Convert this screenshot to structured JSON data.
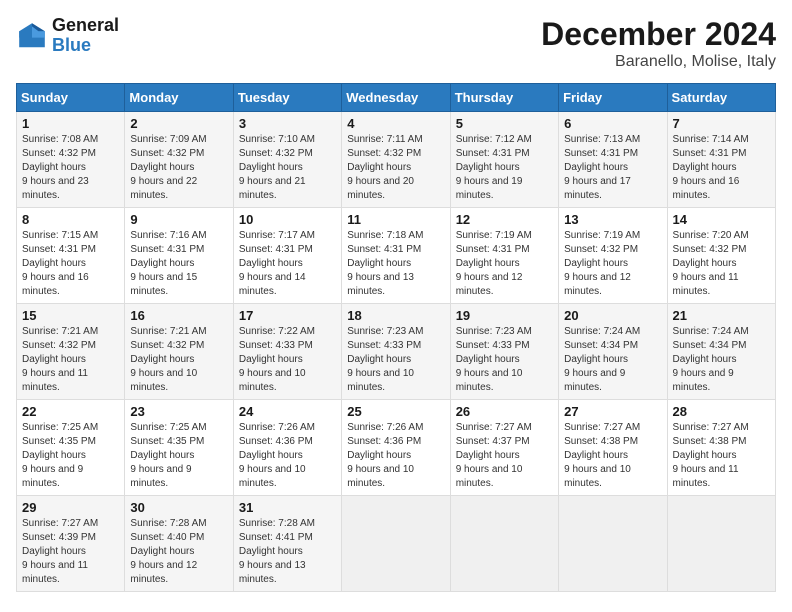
{
  "header": {
    "logo_line1": "General",
    "logo_line2": "Blue",
    "month": "December 2024",
    "location": "Baranello, Molise, Italy"
  },
  "weekdays": [
    "Sunday",
    "Monday",
    "Tuesday",
    "Wednesday",
    "Thursday",
    "Friday",
    "Saturday"
  ],
  "weeks": [
    [
      {
        "day": "1",
        "sunrise": "7:08 AM",
        "sunset": "4:32 PM",
        "daylight": "9 hours and 23 minutes."
      },
      {
        "day": "2",
        "sunrise": "7:09 AM",
        "sunset": "4:32 PM",
        "daylight": "9 hours and 22 minutes."
      },
      {
        "day": "3",
        "sunrise": "7:10 AM",
        "sunset": "4:32 PM",
        "daylight": "9 hours and 21 minutes."
      },
      {
        "day": "4",
        "sunrise": "7:11 AM",
        "sunset": "4:32 PM",
        "daylight": "9 hours and 20 minutes."
      },
      {
        "day": "5",
        "sunrise": "7:12 AM",
        "sunset": "4:31 PM",
        "daylight": "9 hours and 19 minutes."
      },
      {
        "day": "6",
        "sunrise": "7:13 AM",
        "sunset": "4:31 PM",
        "daylight": "9 hours and 17 minutes."
      },
      {
        "day": "7",
        "sunrise": "7:14 AM",
        "sunset": "4:31 PM",
        "daylight": "9 hours and 16 minutes."
      }
    ],
    [
      {
        "day": "8",
        "sunrise": "7:15 AM",
        "sunset": "4:31 PM",
        "daylight": "9 hours and 16 minutes."
      },
      {
        "day": "9",
        "sunrise": "7:16 AM",
        "sunset": "4:31 PM",
        "daylight": "9 hours and 15 minutes."
      },
      {
        "day": "10",
        "sunrise": "7:17 AM",
        "sunset": "4:31 PM",
        "daylight": "9 hours and 14 minutes."
      },
      {
        "day": "11",
        "sunrise": "7:18 AM",
        "sunset": "4:31 PM",
        "daylight": "9 hours and 13 minutes."
      },
      {
        "day": "12",
        "sunrise": "7:19 AM",
        "sunset": "4:31 PM",
        "daylight": "9 hours and 12 minutes."
      },
      {
        "day": "13",
        "sunrise": "7:19 AM",
        "sunset": "4:32 PM",
        "daylight": "9 hours and 12 minutes."
      },
      {
        "day": "14",
        "sunrise": "7:20 AM",
        "sunset": "4:32 PM",
        "daylight": "9 hours and 11 minutes."
      }
    ],
    [
      {
        "day": "15",
        "sunrise": "7:21 AM",
        "sunset": "4:32 PM",
        "daylight": "9 hours and 11 minutes."
      },
      {
        "day": "16",
        "sunrise": "7:21 AM",
        "sunset": "4:32 PM",
        "daylight": "9 hours and 10 minutes."
      },
      {
        "day": "17",
        "sunrise": "7:22 AM",
        "sunset": "4:33 PM",
        "daylight": "9 hours and 10 minutes."
      },
      {
        "day": "18",
        "sunrise": "7:23 AM",
        "sunset": "4:33 PM",
        "daylight": "9 hours and 10 minutes."
      },
      {
        "day": "19",
        "sunrise": "7:23 AM",
        "sunset": "4:33 PM",
        "daylight": "9 hours and 10 minutes."
      },
      {
        "day": "20",
        "sunrise": "7:24 AM",
        "sunset": "4:34 PM",
        "daylight": "9 hours and 9 minutes."
      },
      {
        "day": "21",
        "sunrise": "7:24 AM",
        "sunset": "4:34 PM",
        "daylight": "9 hours and 9 minutes."
      }
    ],
    [
      {
        "day": "22",
        "sunrise": "7:25 AM",
        "sunset": "4:35 PM",
        "daylight": "9 hours and 9 minutes."
      },
      {
        "day": "23",
        "sunrise": "7:25 AM",
        "sunset": "4:35 PM",
        "daylight": "9 hours and 9 minutes."
      },
      {
        "day": "24",
        "sunrise": "7:26 AM",
        "sunset": "4:36 PM",
        "daylight": "9 hours and 10 minutes."
      },
      {
        "day": "25",
        "sunrise": "7:26 AM",
        "sunset": "4:36 PM",
        "daylight": "9 hours and 10 minutes."
      },
      {
        "day": "26",
        "sunrise": "7:27 AM",
        "sunset": "4:37 PM",
        "daylight": "9 hours and 10 minutes."
      },
      {
        "day": "27",
        "sunrise": "7:27 AM",
        "sunset": "4:38 PM",
        "daylight": "9 hours and 10 minutes."
      },
      {
        "day": "28",
        "sunrise": "7:27 AM",
        "sunset": "4:38 PM",
        "daylight": "9 hours and 11 minutes."
      }
    ],
    [
      {
        "day": "29",
        "sunrise": "7:27 AM",
        "sunset": "4:39 PM",
        "daylight": "9 hours and 11 minutes."
      },
      {
        "day": "30",
        "sunrise": "7:28 AM",
        "sunset": "4:40 PM",
        "daylight": "9 hours and 12 minutes."
      },
      {
        "day": "31",
        "sunrise": "7:28 AM",
        "sunset": "4:41 PM",
        "daylight": "9 hours and 13 minutes."
      },
      null,
      null,
      null,
      null
    ]
  ]
}
